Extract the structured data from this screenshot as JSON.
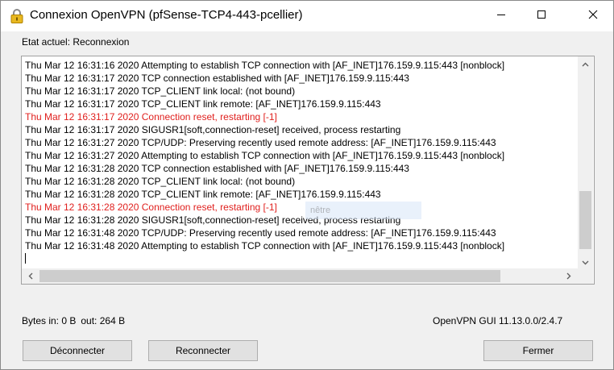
{
  "window": {
    "title": "Connexion OpenVPN (pfSense-TCP4-443-pcellier)"
  },
  "status": {
    "label": "Etat actuel: Reconnexion"
  },
  "log": {
    "lines": [
      {
        "text": "Thu Mar 12 16:31:16 2020 Attempting to establish TCP connection with [AF_INET]176.159.9.115:443 [nonblock]",
        "error": false
      },
      {
        "text": "Thu Mar 12 16:31:17 2020 TCP connection established with [AF_INET]176.159.9.115:443",
        "error": false
      },
      {
        "text": "Thu Mar 12 16:31:17 2020 TCP_CLIENT link local: (not bound)",
        "error": false
      },
      {
        "text": "Thu Mar 12 16:31:17 2020 TCP_CLIENT link remote: [AF_INET]176.159.9.115:443",
        "error": false
      },
      {
        "text": "Thu Mar 12 16:31:17 2020 Connection reset, restarting [-1]",
        "error": true
      },
      {
        "text": "Thu Mar 12 16:31:17 2020 SIGUSR1[soft,connection-reset] received, process restarting",
        "error": false
      },
      {
        "text": "Thu Mar 12 16:31:27 2020 TCP/UDP: Preserving recently used remote address: [AF_INET]176.159.9.115:443",
        "error": false
      },
      {
        "text": "Thu Mar 12 16:31:27 2020 Attempting to establish TCP connection with [AF_INET]176.159.9.115:443 [nonblock]",
        "error": false
      },
      {
        "text": "Thu Mar 12 16:31:28 2020 TCP connection established with [AF_INET]176.159.9.115:443",
        "error": false
      },
      {
        "text": "Thu Mar 12 16:31:28 2020 TCP_CLIENT link local: (not bound)",
        "error": false
      },
      {
        "text": "Thu Mar 12 16:31:28 2020 TCP_CLIENT link remote: [AF_INET]176.159.9.115:443",
        "error": false
      },
      {
        "text": "Thu Mar 12 16:31:28 2020 Connection reset, restarting [-1]",
        "error": true
      },
      {
        "text": "Thu Mar 12 16:31:28 2020 SIGUSR1[soft,connection-reset] received, process restarting",
        "error": false
      },
      {
        "text": "Thu Mar 12 16:31:48 2020 TCP/UDP: Preserving recently used remote address: [AF_INET]176.159.9.115:443",
        "error": false
      },
      {
        "text": "Thu Mar 12 16:31:48 2020 Attempting to establish TCP connection with [AF_INET]176.159.9.115:443 [nonblock]",
        "error": false
      }
    ],
    "ghost_text": "nêtre"
  },
  "stats": {
    "bytes_in": "Bytes in: 0 B",
    "bytes_out": "out: 264 B"
  },
  "version": "OpenVPN GUI 11.13.0.0/2.4.7",
  "buttons": {
    "disconnect": "Déconnecter",
    "reconnect": "Reconnecter",
    "close": "Fermer"
  },
  "colors": {
    "error_text": "#e0201e",
    "window_bg": "#f0f0f0",
    "button_bg": "#e1e1e1"
  },
  "icons": {
    "app": "openvpn-lock-icon",
    "minimize": "minimize-icon",
    "maximize": "maximize-icon",
    "close": "close-icon"
  }
}
